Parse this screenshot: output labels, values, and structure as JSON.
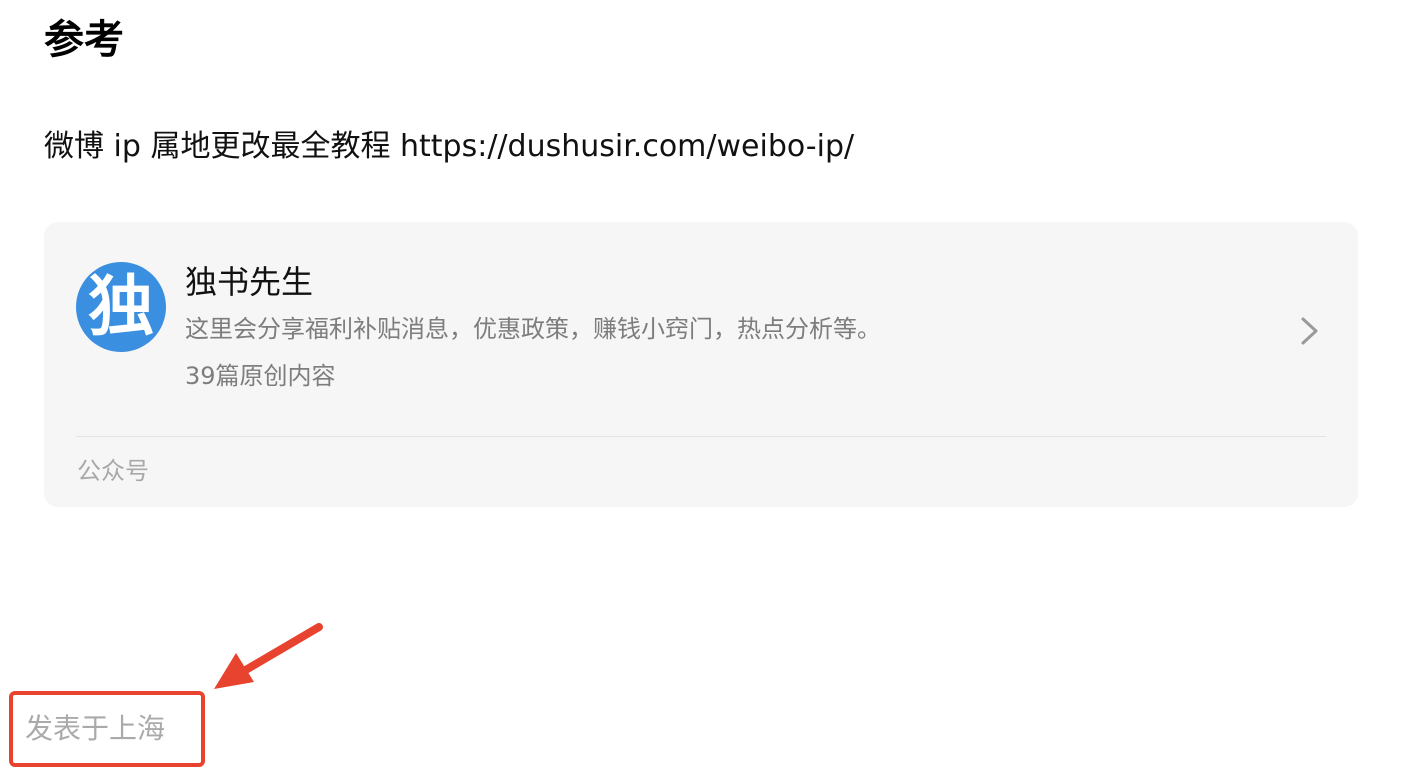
{
  "section": {
    "title": "参考"
  },
  "reference": {
    "label": "微博 ip 属地更改最全教程",
    "url": "https://dushusir.com/weibo-ip/"
  },
  "account_card": {
    "avatar_char": "独",
    "name": "独书先生",
    "description": "这里会分享福利补贴消息，优惠政策，赚钱小窍门，热点分析等。",
    "post_count": "39篇原创内容",
    "type": "公众号"
  },
  "footer": {
    "location": "发表于上海"
  },
  "annotation": {
    "color": "#e8432f"
  },
  "icons": {
    "chevron": "chevron-right-icon",
    "arrow": "red-arrow-icon"
  },
  "colors": {
    "avatar_bg": "#3b8fe0",
    "card_bg": "#f6f6f6",
    "secondary_text": "#7d7d7d"
  }
}
